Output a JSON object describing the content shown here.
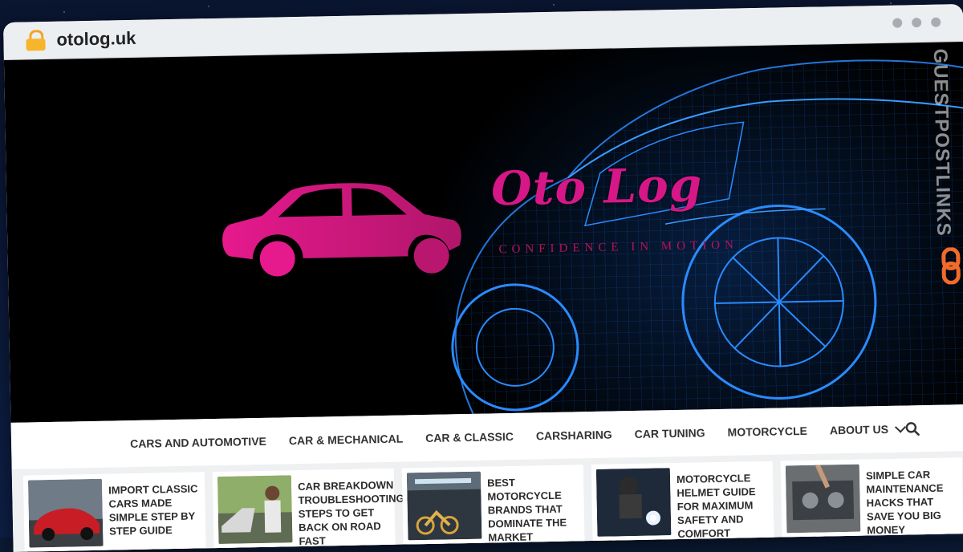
{
  "browser": {
    "url": "otolog.uk"
  },
  "site": {
    "logo_title": "Oto Log",
    "tagline": "CONFIDENCE IN MOTION"
  },
  "side_banner": {
    "text": "GUESTPOSTLINKS"
  },
  "nav": {
    "items": [
      "CARS AND AUTOMOTIVE",
      "CAR & MECHANICAL",
      "CAR & CLASSIC",
      "CARSHARING",
      "CAR TUNING",
      "MOTORCYCLE",
      "ABOUT US"
    ]
  },
  "posts": [
    {
      "title": "IMPORT CLASSIC CARS MADE SIMPLE STEP BY STEP GUIDE"
    },
    {
      "title": "CAR BREAKDOWN TROUBLESHOOTING STEPS TO GET BACK ON ROAD FAST"
    },
    {
      "title": "BEST MOTORCYCLE BRANDS THAT DOMINATE THE MARKET"
    },
    {
      "title": "MOTORCYCLE HELMET GUIDE FOR MAXIMUM SAFETY AND COMFORT"
    },
    {
      "title": "SIMPLE CAR MAINTENANCE HACKS THAT SAVE YOU BIG MONEY"
    }
  ],
  "colors": {
    "brand_pink": "#d61788",
    "wireframe_blue": "#1c7cff",
    "lock_icon": "#f7b52c"
  }
}
